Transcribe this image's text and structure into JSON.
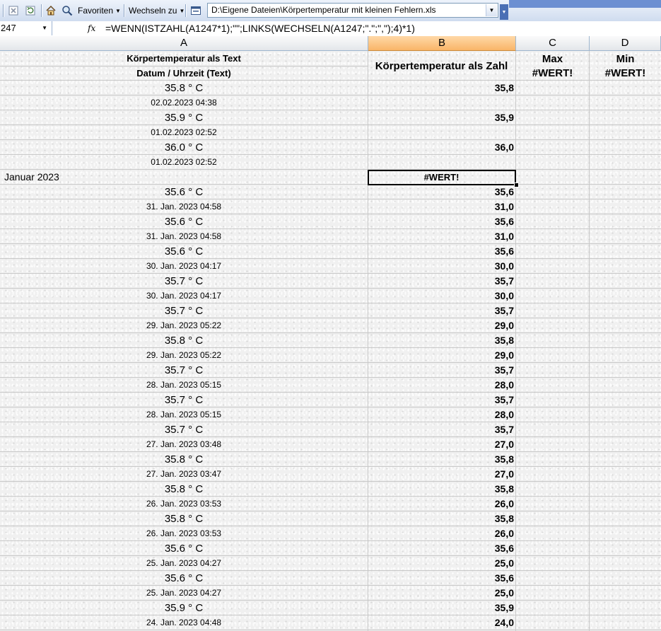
{
  "toolbar": {
    "favoriten_label": "Favoriten",
    "wechseln_label": "Wechseln zu",
    "address": "D:\\Eigene Dateien\\Körpertemperatur mit kleinen Fehlern.xls"
  },
  "formula_bar": {
    "name_box": "247",
    "fx_label": "fx",
    "formula": "=WENN(ISTZAHL(A1247*1);\"\";LINKS(WECHSELN(A1247;\".\";\",\");4)*1)"
  },
  "columns": [
    "A",
    "B",
    "C",
    "D"
  ],
  "header": {
    "a_line1": "Körpertemperatur als Text",
    "a_line2": "Datum / Uhrzeit (Text)",
    "b": "Körpertemperatur als Zahl",
    "c_line1": "Max",
    "c_line2": "#WERT!",
    "d_line1": "Min",
    "d_line2": "#WERT!"
  },
  "rows": [
    {
      "a": "35.8 ° C",
      "b": "35,8",
      "kind": "temp"
    },
    {
      "a": "02.02.2023 04:38",
      "b": "",
      "kind": "date"
    },
    {
      "a": "35.9 ° C",
      "b": "35,9",
      "kind": "temp"
    },
    {
      "a": "01.02.2023 02:52",
      "b": "",
      "kind": "date"
    },
    {
      "a": "36.0 ° C",
      "b": "36,0",
      "kind": "temp"
    },
    {
      "a": "01.02.2023 02:52",
      "b": "",
      "kind": "date"
    },
    {
      "a": "Januar 2023",
      "b": "#WERT!",
      "kind": "month"
    },
    {
      "a": "35.6 ° C",
      "b": "35,6",
      "kind": "temp"
    },
    {
      "a": "31. Jan. 2023 04:58",
      "b": "31,0",
      "kind": "date"
    },
    {
      "a": "35.6 ° C",
      "b": "35,6",
      "kind": "temp"
    },
    {
      "a": "31. Jan. 2023 04:58",
      "b": "31,0",
      "kind": "date"
    },
    {
      "a": "35.6 ° C",
      "b": "35,6",
      "kind": "temp"
    },
    {
      "a": "30. Jan. 2023 04:17",
      "b": "30,0",
      "kind": "date"
    },
    {
      "a": "35.7 ° C",
      "b": "35,7",
      "kind": "temp"
    },
    {
      "a": "30. Jan. 2023 04:17",
      "b": "30,0",
      "kind": "date"
    },
    {
      "a": "35.7 ° C",
      "b": "35,7",
      "kind": "temp"
    },
    {
      "a": "29. Jan. 2023 05:22",
      "b": "29,0",
      "kind": "date"
    },
    {
      "a": "35.8 ° C",
      "b": "35,8",
      "kind": "temp"
    },
    {
      "a": "29. Jan. 2023 05:22",
      "b": "29,0",
      "kind": "date"
    },
    {
      "a": "35.7 ° C",
      "b": "35,7",
      "kind": "temp"
    },
    {
      "a": "28. Jan. 2023 05:15",
      "b": "28,0",
      "kind": "date"
    },
    {
      "a": "35.7 ° C",
      "b": "35,7",
      "kind": "temp"
    },
    {
      "a": "28. Jan. 2023 05:15",
      "b": "28,0",
      "kind": "date"
    },
    {
      "a": "35.7 ° C",
      "b": "35,7",
      "kind": "temp"
    },
    {
      "a": "27. Jan. 2023 03:48",
      "b": "27,0",
      "kind": "date"
    },
    {
      "a": "35.8 ° C",
      "b": "35,8",
      "kind": "temp"
    },
    {
      "a": "27. Jan. 2023 03:47",
      "b": "27,0",
      "kind": "date"
    },
    {
      "a": "35.8 ° C",
      "b": "35,8",
      "kind": "temp"
    },
    {
      "a": "26. Jan. 2023 03:53",
      "b": "26,0",
      "kind": "date"
    },
    {
      "a": "35.8 ° C",
      "b": "35,8",
      "kind": "temp"
    },
    {
      "a": "26. Jan. 2023 03:53",
      "b": "26,0",
      "kind": "date"
    },
    {
      "a": "35.6 ° C",
      "b": "35,6",
      "kind": "temp"
    },
    {
      "a": "25. Jan. 2023 04:27",
      "b": "25,0",
      "kind": "date"
    },
    {
      "a": "35.6 ° C",
      "b": "35,6",
      "kind": "temp"
    },
    {
      "a": "25. Jan. 2023 04:27",
      "b": "25,0",
      "kind": "date"
    },
    {
      "a": "35.9 ° C",
      "b": "35,9",
      "kind": "temp"
    },
    {
      "a": "24. Jan. 2023 04:48",
      "b": "24,0",
      "kind": "date"
    }
  ]
}
